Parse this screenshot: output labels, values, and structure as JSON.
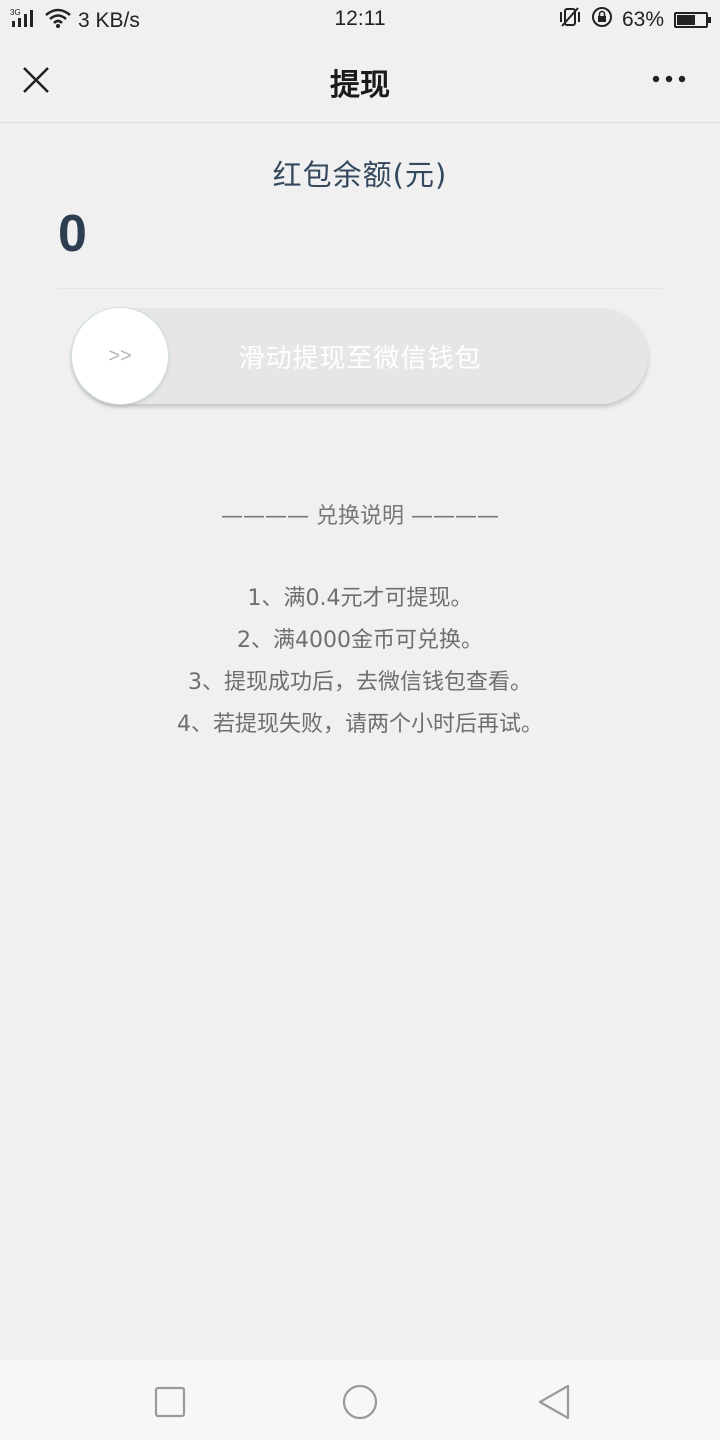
{
  "status_bar": {
    "network": "3G",
    "speed": "3 KB/s",
    "time": "12:11",
    "battery": "63%",
    "battery_level": 0.63
  },
  "nav": {
    "title": "提现",
    "close_icon": "close-icon",
    "more_icon": "more-icon"
  },
  "balance": {
    "label": "红包余额(元)",
    "value": "0"
  },
  "slider": {
    "knob_label": ">>",
    "hint": "滑动提现至微信钱包"
  },
  "instructions": {
    "title": "———— 兑换说明 ————",
    "items": [
      "1、满0.4元才可提现。",
      "2、满4000金币可兑换。",
      "3、提现成功后，去微信钱包查看。",
      "4、若提现失败，请两个小时后再试。"
    ]
  },
  "system_nav": {
    "recents_icon": "square-icon",
    "home_icon": "circle-icon",
    "back_icon": "triangle-back-icon"
  },
  "colors": {
    "background": "#f0f0f0",
    "balance_text": "#2c3e50",
    "slider_track": "#e6e6e6"
  }
}
